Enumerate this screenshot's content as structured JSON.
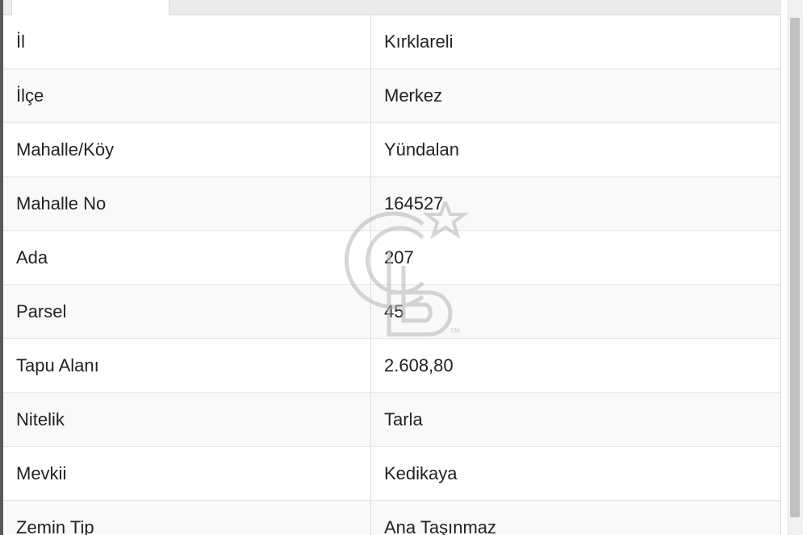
{
  "rows": [
    {
      "label": "İl",
      "value": "Kırklareli"
    },
    {
      "label": "İlçe",
      "value": "Merkez"
    },
    {
      "label": "Mahalle/Köy",
      "value": "Yündalan"
    },
    {
      "label": "Mahalle No",
      "value": "164527"
    },
    {
      "label": "Ada",
      "value": "207"
    },
    {
      "label": "Parsel",
      "value": "45"
    },
    {
      "label": "Tapu Alanı",
      "value": "2.608,80"
    },
    {
      "label": "Nitelik",
      "value": "Tarla"
    },
    {
      "label": "Mevkii",
      "value": "Kedikaya"
    },
    {
      "label": "Zemin Tip",
      "value": "Ana Taşınmaz"
    }
  ],
  "watermark": {
    "icon": "cb-logo-icon",
    "mark": "SM"
  },
  "colors": {
    "border": "#dddddd",
    "stripe": "#f9f9f9",
    "text": "#222222"
  }
}
